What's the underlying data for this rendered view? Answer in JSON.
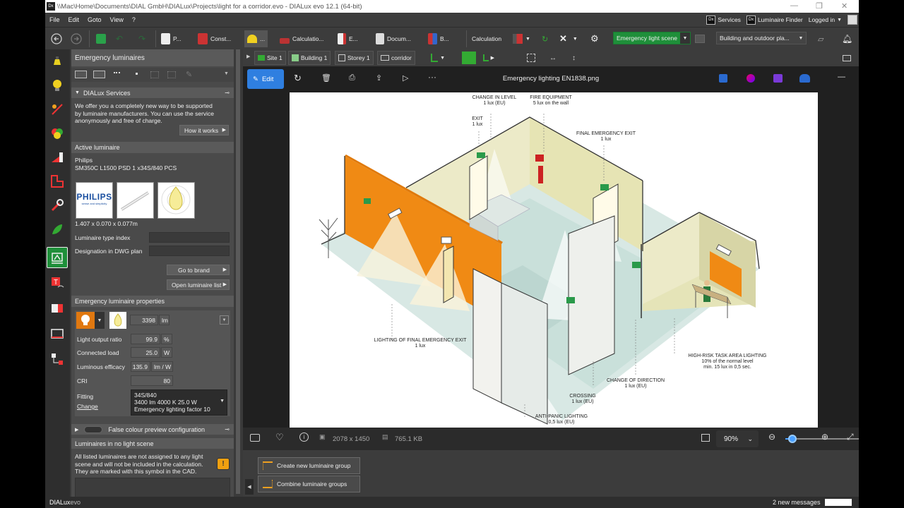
{
  "window": {
    "title": "\\\\Mac\\Home\\Documents\\DIAL GmbH\\DIALux\\Projects\\light for a corridor.evo - DIALux evo 12.1  (64-bit)",
    "app_icon": "Dx"
  },
  "menu": {
    "items": [
      "File",
      "Edit",
      "Goto",
      "View",
      "?"
    ],
    "services": "Services",
    "luminaire_finder": "Luminaire Finder",
    "logged_in": "Logged in"
  },
  "toolbar": {
    "items": [
      "P...",
      "Const...",
      "...",
      "Calculatio...",
      "E...",
      "Docum...",
      "B..."
    ],
    "calculation_label": "Calculation",
    "scene_combo": "Emergency light scene",
    "building_combo": "Building and outdoor pla..."
  },
  "tabs3d": {
    "site": "Site 1",
    "building": "Building 1",
    "storey": "Storey 1",
    "room": "corridor"
  },
  "panel": {
    "title": "Emergency luminaires",
    "services": {
      "header": "DIALux Services",
      "text": [
        "We offer you a completely new way to be supported",
        "by luminaire manufacturers. You can use the service",
        "anonymously and free of charge."
      ],
      "how_it_works": "How it works"
    },
    "active": {
      "header": "Active luminaire",
      "manufacturer": "Philips",
      "model": "SM350C L1500 PSD 1 x34S/840 PCS",
      "logo_text": "PHILIPS",
      "logo_tagline": "sense and simplicity",
      "dimensions": "1.407 x 0.070 x 0.077m",
      "type_index_label": "Luminaire type index",
      "designation_label": "Designation in DWG plan",
      "go_to_brand": "Go to brand",
      "open_list": "Open luminaire list"
    },
    "props": {
      "header": "Emergency luminaire properties",
      "lumens": "3398",
      "lumens_unit": "lm",
      "rows": [
        {
          "label": "Light output ratio",
          "value": "99.9",
          "unit": "%"
        },
        {
          "label": "Connected load",
          "value": "25.0",
          "unit": "W"
        },
        {
          "label": "Luminous efficacy",
          "value": "135.9",
          "unit": "lm / W"
        },
        {
          "label": "CRI",
          "value": "80",
          "unit": ""
        }
      ],
      "fitting_label": "Fitting",
      "change_label": "Change",
      "fitting_lines": [
        "34S/840",
        "3400 lm   4000 K   25.0 W",
        "Emergency lighting factor  10"
      ]
    },
    "false_colour": "False colour preview configuration",
    "no_scene": {
      "header": "Luminaires in no light scene",
      "text": [
        "All listed luminaires are not assigned to any light",
        "scene and will not be included in the calculation.",
        "They are marked with this symbol in the CAD."
      ]
    }
  },
  "viewer": {
    "edit": "Edit",
    "filename": "Emergency lighting EN1838.png",
    "dimensions": "2078 x 1450",
    "filesize": "765.1 KB",
    "zoom": "90%",
    "zoom_level": 0.1
  },
  "illustration": {
    "labels": [
      {
        "id": "change-level",
        "lines": [
          "CHANGE IN LEVEL",
          "1 lux (EU)"
        ]
      },
      {
        "id": "fire-equipment",
        "lines": [
          "FIRE EQUIPMENT",
          "5 lux on the wall"
        ]
      },
      {
        "id": "exit",
        "lines": [
          "EXIT",
          "1 lux"
        ]
      },
      {
        "id": "final-exit",
        "lines": [
          "FINAL EMERGENCY EXIT",
          "1 lux"
        ]
      },
      {
        "id": "lighting-final-exit",
        "lines": [
          "LIGHTING OF FINAL EMERGENCY EXIT",
          "1 lux"
        ]
      },
      {
        "id": "high-risk",
        "lines": [
          "HIGH-RISK TASK AREA LIGHTING",
          "10% of the normal level",
          "min. 15 lux in 0,5 sec."
        ]
      },
      {
        "id": "change-direction",
        "lines": [
          "CHANGE OF DIRECTION",
          "1 lux (EU)"
        ]
      },
      {
        "id": "crossing",
        "lines": [
          "CROSSING",
          "1 lux (EU)"
        ]
      },
      {
        "id": "anti-panic",
        "lines": [
          "ANTI-PANIC LIGHTING",
          "0,5 lux (EU)"
        ]
      }
    ]
  },
  "groups": {
    "create": "Create new luminaire group",
    "combine": "Combine luminaire groups"
  },
  "status": {
    "brand": "DIALux",
    "brand_suffix": "evo",
    "messages": "2 new messages"
  },
  "colors": {
    "accent_green": "#1f8f3a",
    "edit_blue": "#2f7fe0",
    "orange_wall": "#f08a14"
  }
}
